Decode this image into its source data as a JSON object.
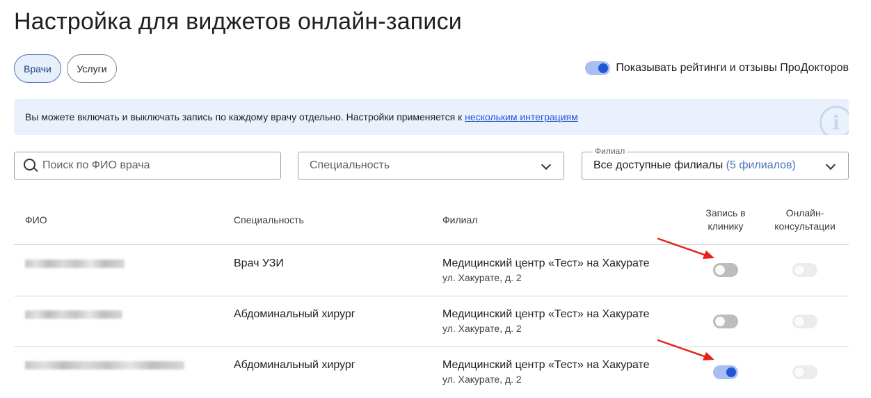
{
  "page": {
    "title": "Настройка для виджетов онлайн-записи"
  },
  "tabs": [
    {
      "label": "Врачи",
      "active": true
    },
    {
      "label": "Услуги",
      "active": false
    }
  ],
  "rating_toggle": {
    "label": "Показывать рейтинги и отзывы ПроДокторов",
    "checked": true
  },
  "info_banner": {
    "text": "Вы можете включать и выключать запись по каждому врачу отдельно. Настройки применяется к ",
    "link_text": "нескольким интеграциям",
    "icon": "info-icon"
  },
  "filters": {
    "search": {
      "placeholder": "Поиск по ФИО врача",
      "value": ""
    },
    "specialty": {
      "placeholder": "Специальность"
    },
    "branch": {
      "label": "Филиал",
      "value": "Все доступные филиалы",
      "count": "(5 филиалов)"
    }
  },
  "table": {
    "headers": {
      "fio": "ФИО",
      "specialty": "Специальность",
      "branch": "Филиал",
      "clinic_line1": "Запись в",
      "clinic_line2": "клинику",
      "online_line1": "Онлайн-",
      "online_line2": "консультации"
    },
    "rows": [
      {
        "name_hidden": true,
        "specialty": "Врач УЗИ",
        "branch_name": "Медицинский центр «Тест» на Хакурате",
        "branch_address": "ул. Хакурате, д. 2",
        "clinic_booking": false,
        "online_consult": false,
        "online_disabled": true
      },
      {
        "name_hidden": true,
        "specialty": "Абдоминальный хирург",
        "branch_name": "Медицинский центр «Тест» на Хакурате",
        "branch_address": "ул. Хакурате, д. 2",
        "clinic_booking": false,
        "online_consult": false,
        "online_disabled": true
      },
      {
        "name_hidden": true,
        "specialty": "Абдоминальный хирург",
        "branch_name": "Медицинский центр «Тест» на Хакурате",
        "branch_address": "ул. Хакурате, д. 2",
        "clinic_booking": true,
        "online_consult": false,
        "online_disabled": true
      }
    ]
  },
  "colors": {
    "accent": "#1e56d6",
    "toggle_track_on": "#a9bff0",
    "banner_bg": "#eaf1fd",
    "annotation_arrow": "#e5221b"
  }
}
